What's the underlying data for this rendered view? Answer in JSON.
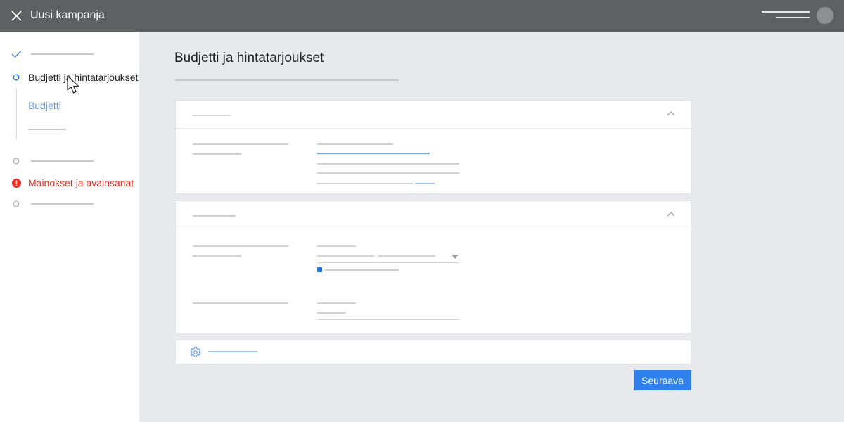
{
  "header": {
    "title": "Uusi kampanja"
  },
  "sidebar": {
    "steps": [
      {
        "state": "done",
        "label": ""
      },
      {
        "state": "current",
        "label": "Budjetti ja hintatarjoukset"
      },
      {
        "state": "pending",
        "label": ""
      },
      {
        "state": "error",
        "label": "Mainokset ja avainsanat"
      },
      {
        "state": "pending",
        "label": ""
      }
    ],
    "substeps": [
      {
        "label": "Budjetti",
        "active": true
      },
      {
        "label": "",
        "active": false
      }
    ]
  },
  "main": {
    "title": "Budjetti ja hintatarjoukset",
    "next_label": "Seuraava"
  },
  "colors": {
    "topbar": "#5f6061",
    "accent": "#1a73e8",
    "error": "#ea2b20",
    "button": "#2f80ed",
    "substep_active": "#6a9be8"
  },
  "icons": {
    "close": "close-icon",
    "check": "check-icon",
    "gear": "gear-icon",
    "chevron": "chevron-up-icon",
    "error": "error-icon"
  }
}
